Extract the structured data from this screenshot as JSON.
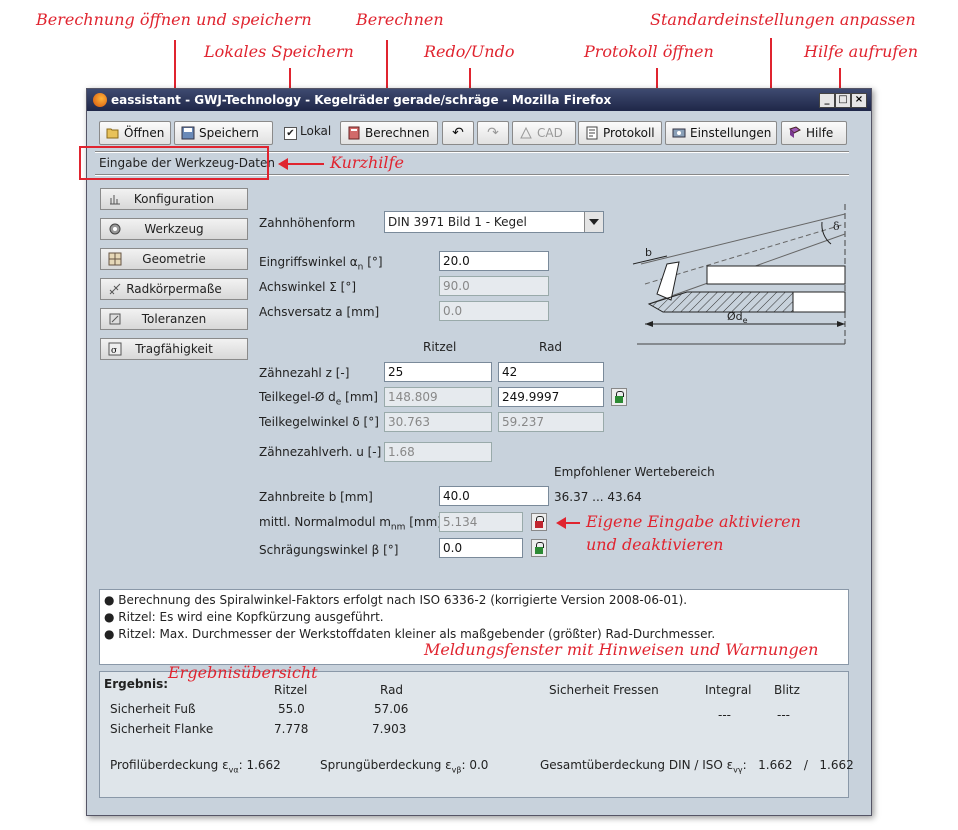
{
  "annotations": {
    "open_save": "Berechnung öffnen und speichern",
    "local_save": "Lokales Speichern",
    "calculate": "Berechnen",
    "redo_undo": "Redo/Undo",
    "protocol": "Protokoll öffnen",
    "settings": "Standardeinstellungen anpassen",
    "help": "Hilfe aufrufen",
    "quick_help": "Kurzhilfe",
    "own_input_1": "Eigene Eingabe aktivieren",
    "own_input_2": "und deaktivieren",
    "messages": "Meldungsfenster mit Hinweisen und Warnungen",
    "result_overview": "Ergebnisübersicht"
  },
  "window": {
    "title": "eassistant - GWJ-Technology - Kegelräder gerade/schräge - Mozilla Firefox",
    "controls": [
      "_",
      "□",
      "×"
    ]
  },
  "toolbar": {
    "open": "Öffnen",
    "save": "Speichern",
    "local_checked": "✔",
    "local": "Lokal",
    "calculate": "Berechnen",
    "undo": "↶",
    "redo": "↷",
    "cad": "CAD",
    "protocol": "Protokoll",
    "settings": "Einstellungen",
    "help": "Hilfe"
  },
  "hint_text": "Eingabe der Werkzeug-Daten",
  "nav": [
    "Konfiguration",
    "Werkzeug",
    "Geometrie",
    "Radkörpermaße",
    "Toleranzen",
    "Tragfähigkeit"
  ],
  "form": {
    "tooth_form_label": "Zahnhöhenform",
    "tooth_form_value": "DIN 3971 Bild 1 - Kegel",
    "pressure_angle_label": "Eingriffswinkel α",
    "pressure_angle_sub": "n",
    "pressure_angle_unit": " [°]",
    "pressure_angle_value": "20.0",
    "shaft_angle_label": "Achswinkel Σ [°]",
    "shaft_angle_value": "90.0",
    "offset_label": "Achsversatz a [mm]",
    "offset_value": "0.0",
    "col_pinion": "Ritzel",
    "col_wheel": "Rad",
    "teeth_label": "Zähnezahl z [-]",
    "teeth_pinion": "25",
    "teeth_wheel": "42",
    "pitch_dia_label": "Teilkegel-Ø d",
    "pitch_dia_sub": "e",
    "pitch_dia_unit": " [mm]",
    "pitch_dia_pinion": "148.809",
    "pitch_dia_wheel": "249.9997",
    "pitch_angle_label": "Teilkegelwinkel δ [°]",
    "pitch_angle_pinion": "30.763",
    "pitch_angle_wheel": "59.237",
    "ratio_label": "Zähnezahlverh. u [-]",
    "ratio_value": "1.68",
    "recommended_label": "Empfohlener Wertebereich",
    "face_width_label": "Zahnbreite b [mm]",
    "face_width_value": "40.0",
    "face_width_range": "36.37 ... 43.64",
    "module_label": "mittl. Normalmodul m",
    "module_sub": "nm",
    "module_unit": " [mm]",
    "module_value": "5.134",
    "helix_label": "Schrägungswinkel β [°]",
    "helix_value": "0.0"
  },
  "diagram": {
    "b": "b",
    "delta": "δ",
    "de": "Ød",
    "de_sub": "e"
  },
  "messages": [
    "● Berechnung des Spiralwinkel-Faktors erfolgt nach ISO 6336-2 (korrigierte Version 2008-06-01).",
    "● Ritzel: Es wird eine Kopfkürzung ausgeführt.",
    "● Ritzel: Max. Durchmesser der Werkstoffdaten kleiner als maßgebender (größter) Rad-Durchmesser."
  ],
  "result": {
    "title": "Ergebnis:",
    "col_pinion": "Ritzel",
    "col_wheel": "Rad",
    "safety_fressen": "Sicherheit Fressen",
    "integral": "Integral",
    "blitz": "Blitz",
    "integral_value": "---",
    "blitz_value": "---",
    "foot_label": "Sicherheit Fuß",
    "foot_pinion": "55.0",
    "foot_wheel": "57.06",
    "flank_label": "Sicherheit Flanke",
    "flank_pinion": "7.778",
    "flank_wheel": "7.903",
    "profile_label": "Profilüberdeckung ε",
    "profile_sub": "vα",
    "profile_value": ": 1.662",
    "jump_label": "Sprungüberdeckung ε",
    "jump_sub": "vβ",
    "jump_value": ": 0.0",
    "total_label": "Gesamtüberdeckung DIN / ISO ε",
    "total_sub": "vγ",
    "total_value": ":   1.662   /   1.662"
  }
}
